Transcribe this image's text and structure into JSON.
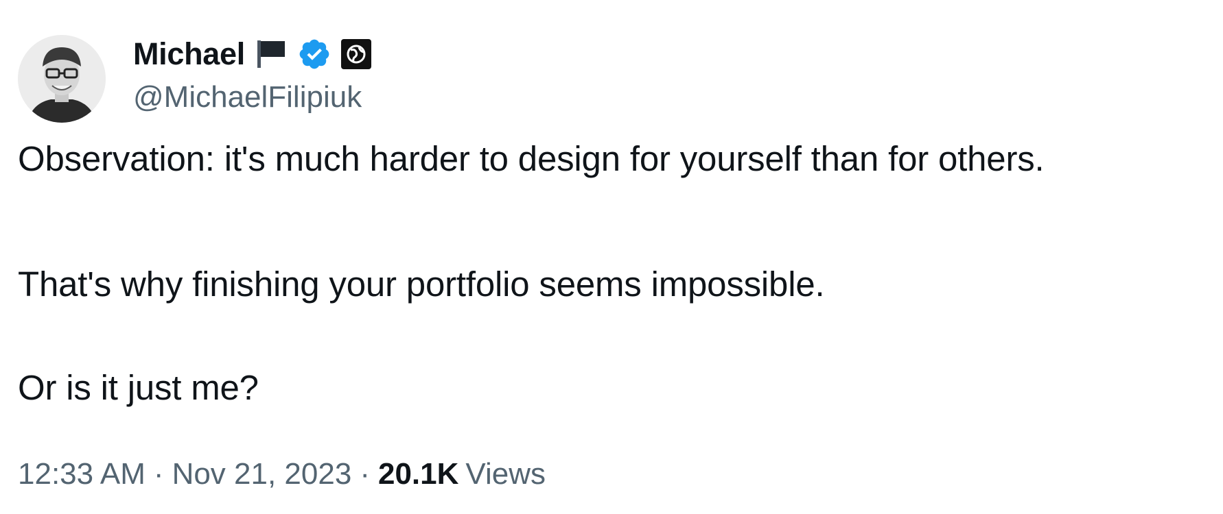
{
  "author": {
    "display_name": "Michael",
    "handle": "@MichaelFilipiuk",
    "avatar_icon": "person-photo-avatar",
    "badges": [
      "flag-icon",
      "verified-badge-icon",
      "affiliate-globe-icon"
    ],
    "colors": {
      "verified": "#1d9bf0",
      "secondary_text": "#536471",
      "primary_text": "#0f1419"
    }
  },
  "tweet": {
    "paragraphs": [
      "Observation: it's much harder to design for yourself than for others.",
      "That's why finishing your portfolio seems impossible.",
      "Or is it just me?"
    ]
  },
  "meta": {
    "time": "12:33 AM",
    "separator": "·",
    "date": "Nov 21, 2023",
    "views_count": "20.1K",
    "views_label": "Views"
  }
}
